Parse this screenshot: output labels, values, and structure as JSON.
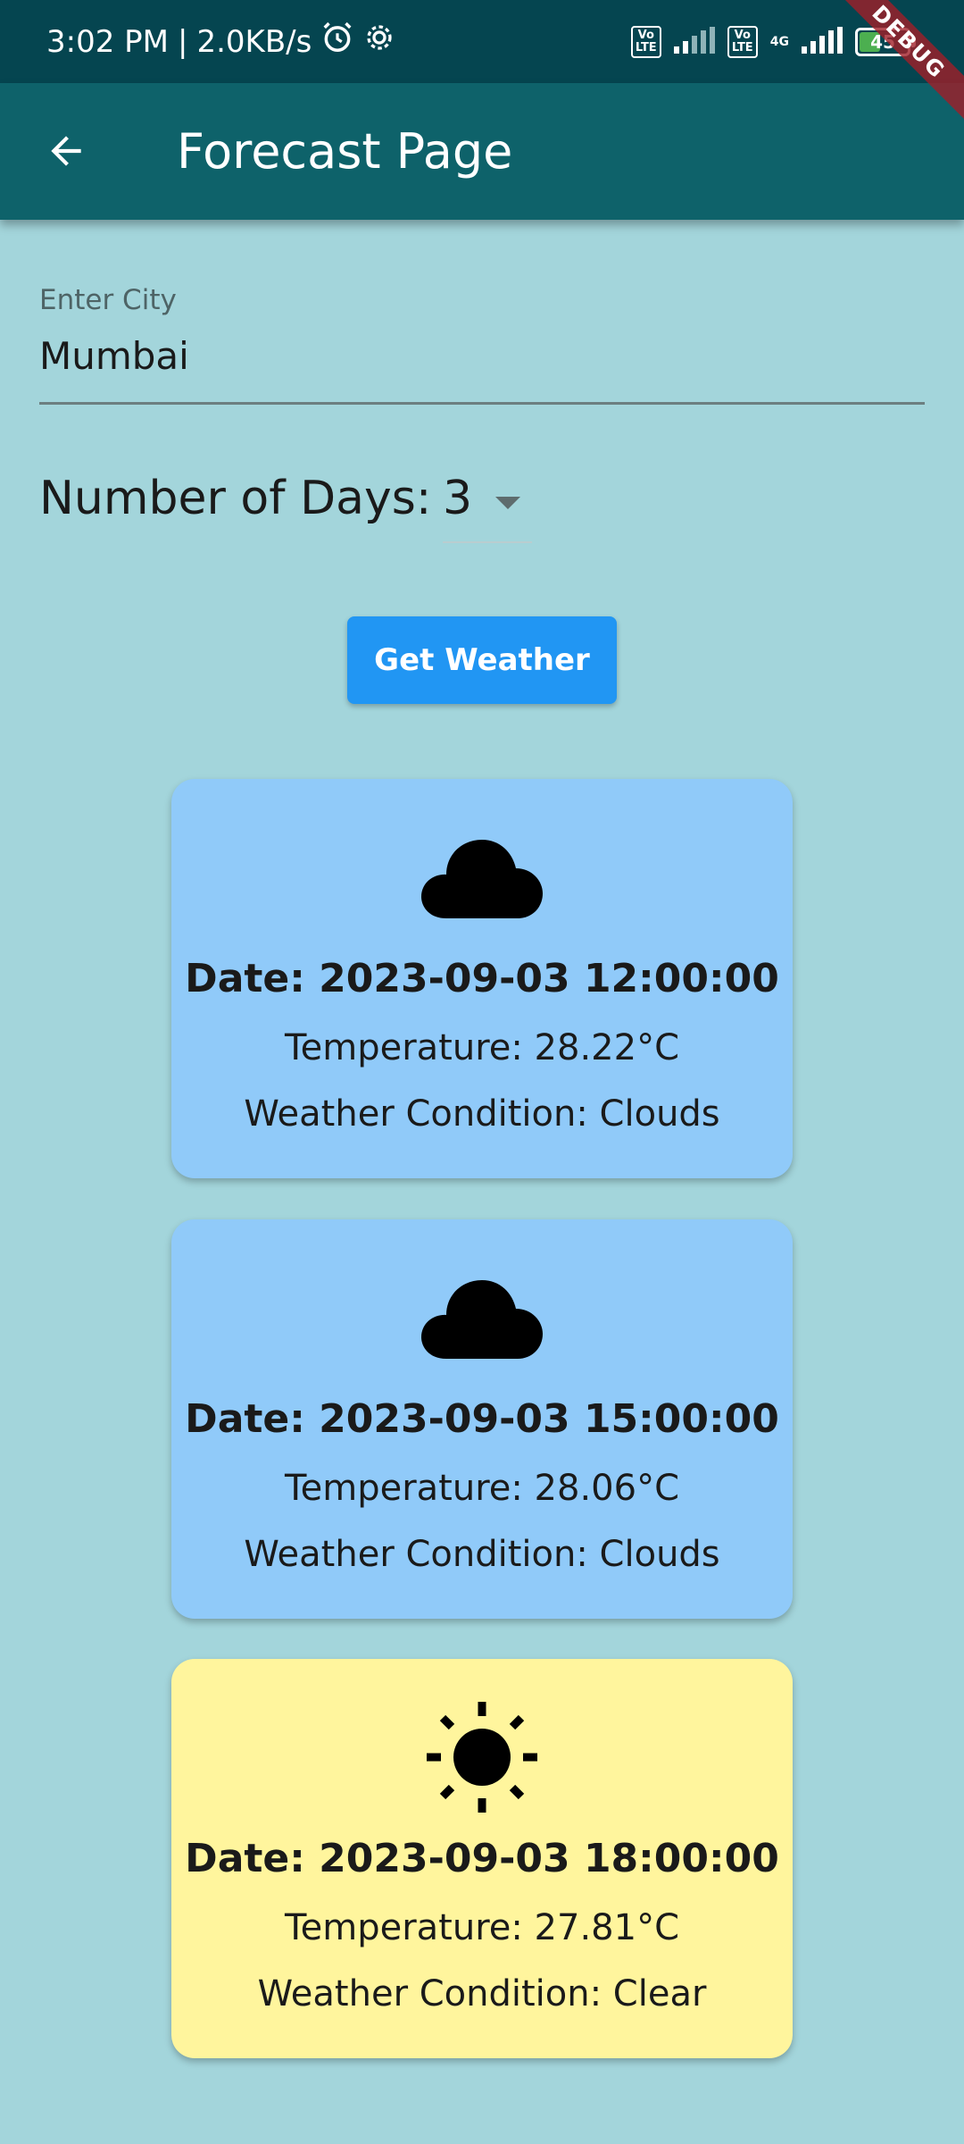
{
  "status_bar": {
    "time": "3:02 PM",
    "separator": "|",
    "speed": "2.0KB/s",
    "volte1": "Vo LTE",
    "volte2": "Vo LTE",
    "network": "4G",
    "battery": "45",
    "battery_level_percent": 45,
    "debug_label": "DEBUG"
  },
  "app_bar": {
    "title": "Forecast Page",
    "back_icon": "arrow-back-icon"
  },
  "city_field": {
    "label": "Enter City",
    "value": "Mumbai"
  },
  "days": {
    "label": "Number of Days:",
    "selected": "3"
  },
  "button": {
    "label": "Get Weather",
    "color": "#2196f3"
  },
  "colors": {
    "background": "#a3d5db",
    "app_bar": "#0e626a",
    "status_bar": "#054550",
    "cloud_card": "#90caf9",
    "clear_card": "#fff59d"
  },
  "forecasts": [
    {
      "icon": "cloud-icon",
      "date": "Date: 2023-09-03 12:00:00",
      "temperature": "Temperature: 28.22°C",
      "condition": "Weather Condition: Clouds"
    },
    {
      "icon": "cloud-icon",
      "date": "Date: 2023-09-03 15:00:00",
      "temperature": "Temperature: 28.06°C",
      "condition": "Weather Condition: Clouds"
    },
    {
      "icon": "sun-icon",
      "date": "Date: 2023-09-03 18:00:00",
      "temperature": "Temperature: 27.81°C",
      "condition": "Weather Condition: Clear"
    }
  ]
}
